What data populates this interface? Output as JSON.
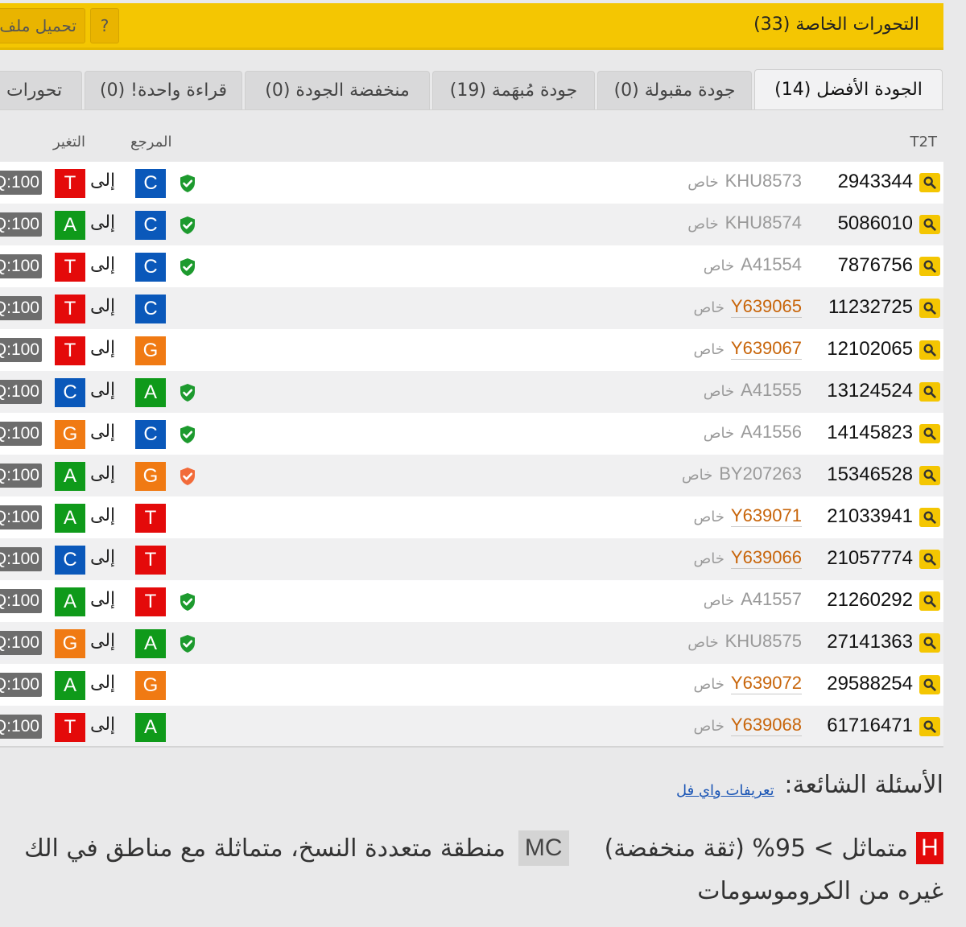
{
  "header": {
    "title": "التحورات الخاصة (33)",
    "help_label": "?",
    "upload_label": "تحميل ملف"
  },
  "tabs": [
    {
      "label": "الجودة الأفضل (14)",
      "active": true
    },
    {
      "label": "جودة مقبولة (0)",
      "active": false
    },
    {
      "label": "جودة مُبهَمة (19)",
      "active": false
    },
    {
      "label": "منخفضة الجودة (0)",
      "active": false
    },
    {
      "label": "قراءة واحدة! (0)",
      "active": false
    },
    {
      "label": "تحورات ا",
      "active": false
    }
  ],
  "columns": {
    "position": "T2T",
    "reference": "المرجع",
    "change": "التغير"
  },
  "colors": {
    "A": "#0f9a1a",
    "C": "#0a58ba",
    "G": "#f07a13",
    "T": "#e40a0a",
    "shield_green": "#1d9a2e",
    "shield_orange": "#f26b3a",
    "accent": "#f4c602"
  },
  "rows": [
    {
      "pos": "2943344",
      "snp": "KHU8573",
      "private": "خاص",
      "link": false,
      "shield": "green",
      "ref": "C",
      "to": "إلى",
      "der": "T",
      "q": "Q:100"
    },
    {
      "pos": "5086010",
      "snp": "KHU8574",
      "private": "خاص",
      "link": false,
      "shield": "green",
      "ref": "C",
      "to": "إلى",
      "der": "A",
      "q": "Q:100"
    },
    {
      "pos": "7876756",
      "snp": "A41554",
      "private": "خاص",
      "link": false,
      "shield": "green",
      "ref": "C",
      "to": "إلى",
      "der": "T",
      "q": "Q:100"
    },
    {
      "pos": "11232725",
      "snp": "Y639065",
      "private": "خاص",
      "link": true,
      "shield": "none",
      "ref": "C",
      "to": "إلى",
      "der": "T",
      "q": "Q:100"
    },
    {
      "pos": "12102065",
      "snp": "Y639067",
      "private": "خاص",
      "link": true,
      "shield": "none",
      "ref": "G",
      "to": "إلى",
      "der": "T",
      "q": "Q:100"
    },
    {
      "pos": "13124524",
      "snp": "A41555",
      "private": "خاص",
      "link": false,
      "shield": "green",
      "ref": "A",
      "to": "إلى",
      "der": "C",
      "q": "Q:100"
    },
    {
      "pos": "14145823",
      "snp": "A41556",
      "private": "خاص",
      "link": false,
      "shield": "green",
      "ref": "C",
      "to": "إلى",
      "der": "G",
      "q": "Q:100"
    },
    {
      "pos": "15346528",
      "snp": "BY207263",
      "private": "خاص",
      "link": false,
      "shield": "orange",
      "ref": "G",
      "to": "إلى",
      "der": "A",
      "q": "Q:100"
    },
    {
      "pos": "21033941",
      "snp": "Y639071",
      "private": "خاص",
      "link": true,
      "shield": "none",
      "ref": "T",
      "to": "إلى",
      "der": "A",
      "q": "Q:100"
    },
    {
      "pos": "21057774",
      "snp": "Y639066",
      "private": "خاص",
      "link": true,
      "shield": "none",
      "ref": "T",
      "to": "إلى",
      "der": "C",
      "q": "Q:100"
    },
    {
      "pos": "21260292",
      "snp": "A41557",
      "private": "خاص",
      "link": false,
      "shield": "green",
      "ref": "T",
      "to": "إلى",
      "der": "A",
      "q": "Q:100"
    },
    {
      "pos": "27141363",
      "snp": "KHU8575",
      "private": "خاص",
      "link": false,
      "shield": "green",
      "ref": "A",
      "to": "إلى",
      "der": "G",
      "q": "Q:100"
    },
    {
      "pos": "29588254",
      "snp": "Y639072",
      "private": "خاص",
      "link": true,
      "shield": "none",
      "ref": "G",
      "to": "إلى",
      "der": "A",
      "q": "Q:100"
    },
    {
      "pos": "61716471",
      "snp": "Y639068",
      "private": "خاص",
      "link": true,
      "shield": "none",
      "ref": "A",
      "to": "إلى",
      "der": "T",
      "q": "Q:100"
    }
  ],
  "faq": {
    "title": "الأسئلة الشائعة:",
    "link": "تعريفات واي فل",
    "h_badge": "H",
    "h_text": "متماثل > 95% (ثقة منخفضة)",
    "mc_badge": "MC",
    "mc_text": "منطقة متعددة النسخ، متماثلة مع مناطق في الك",
    "mc_text_cont": "غيره من الكروموسومات"
  }
}
